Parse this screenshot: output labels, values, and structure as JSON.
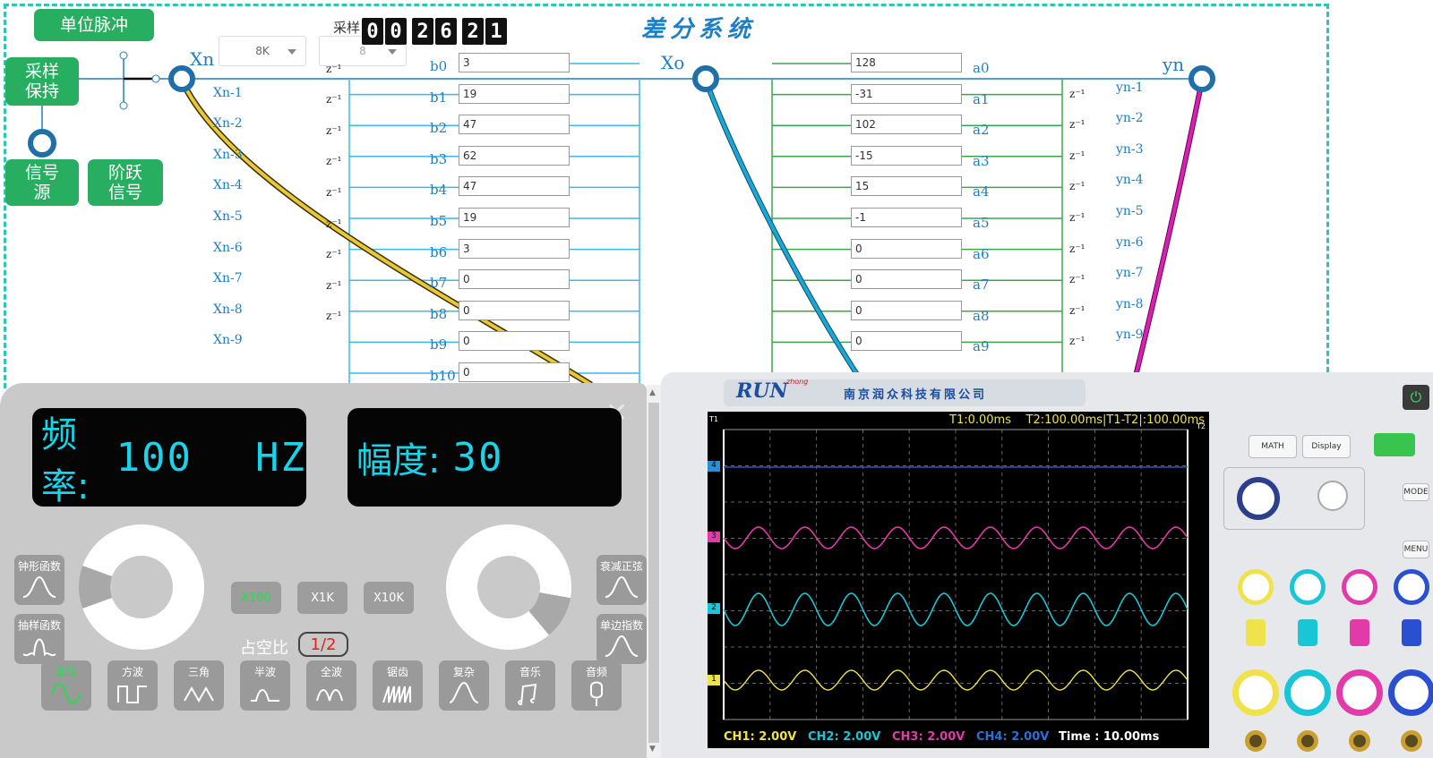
{
  "diagram": {
    "title": "差分系统",
    "unit_pulse": "单位脉冲",
    "sample_hold": [
      "采样",
      "保持"
    ],
    "signal_source": [
      "信号",
      "源"
    ],
    "step_signal": [
      "阶跃",
      "信号"
    ],
    "rate_select": "8K",
    "order_select": "8",
    "sample_label": "采样",
    "counter_digits": [
      "0",
      "0",
      "2",
      "6",
      "2",
      "1"
    ],
    "xn_label": "Xn",
    "xo_label": "Xo",
    "yn_label": "yn",
    "z_label": "z⁻¹",
    "x_delays": [
      "Xn-1",
      "Xn-2",
      "Xn-3",
      "Xn-4",
      "Xn-5",
      "Xn-6",
      "Xn-7",
      "Xn-8",
      "Xn-9"
    ],
    "y_delays": [
      "yn-1",
      "yn-2",
      "yn-3",
      "yn-4",
      "yn-5",
      "yn-6",
      "yn-7",
      "yn-8",
      "yn-9"
    ],
    "b_labels": [
      "b0",
      "b1",
      "b2",
      "b3",
      "b4",
      "b5",
      "b6",
      "b7",
      "b8",
      "b9",
      "b10"
    ],
    "b_values": [
      "3",
      "19",
      "47",
      "62",
      "47",
      "19",
      "3",
      "0",
      "0",
      "0",
      "0"
    ],
    "a_labels": [
      "a0",
      "a1",
      "a2",
      "a3",
      "a4",
      "a5",
      "a6",
      "a7",
      "a8",
      "a9"
    ],
    "a_values": [
      "128",
      "-31",
      "102",
      "-15",
      "15",
      "-1",
      "0",
      "0",
      "0",
      "0"
    ]
  },
  "generator": {
    "freq_label": "频率:",
    "freq_value": "100",
    "freq_unit": "HZ",
    "amp_label": "幅度:",
    "amp_value": "30",
    "left_funcs": [
      "钟形函数",
      "抽样函数"
    ],
    "right_funcs": [
      "衰减正弦",
      "单边指数"
    ],
    "multipliers": [
      "X100",
      "X1K",
      "X10K"
    ],
    "duty_label": "占空比",
    "duty_value": "1/2",
    "waveforms": [
      "正弦",
      "方波",
      "三角",
      "半波",
      "全波",
      "锯齿",
      "复杂",
      "音乐",
      "音频"
    ],
    "active_color": "#22e04a",
    "lcd_color": "#19d4e8"
  },
  "scope": {
    "brand": "RUN",
    "brand_small": "zhong",
    "company": "南京润众科技有限公司",
    "cursor_info": "T1:0.00ms    T2:100.00ms|T1-T2|:100.00ms",
    "t1": "T1",
    "t2": "T2",
    "ch_markers": [
      "4",
      "3",
      "2",
      "1"
    ],
    "ch1": "CH1:  2.00V",
    "ch2": "CH2:  2.00V",
    "ch3": "CH3:  2.00V",
    "ch4": "CH4:  2.00V",
    "time": "Time : 10.00ms",
    "buttons": [
      "MATH",
      "Display",
      "MODE",
      "MENU"
    ],
    "ch_colors": [
      "#f0e24a",
      "#19c6d6",
      "#e23aa8",
      "#2b4fd1"
    ]
  }
}
